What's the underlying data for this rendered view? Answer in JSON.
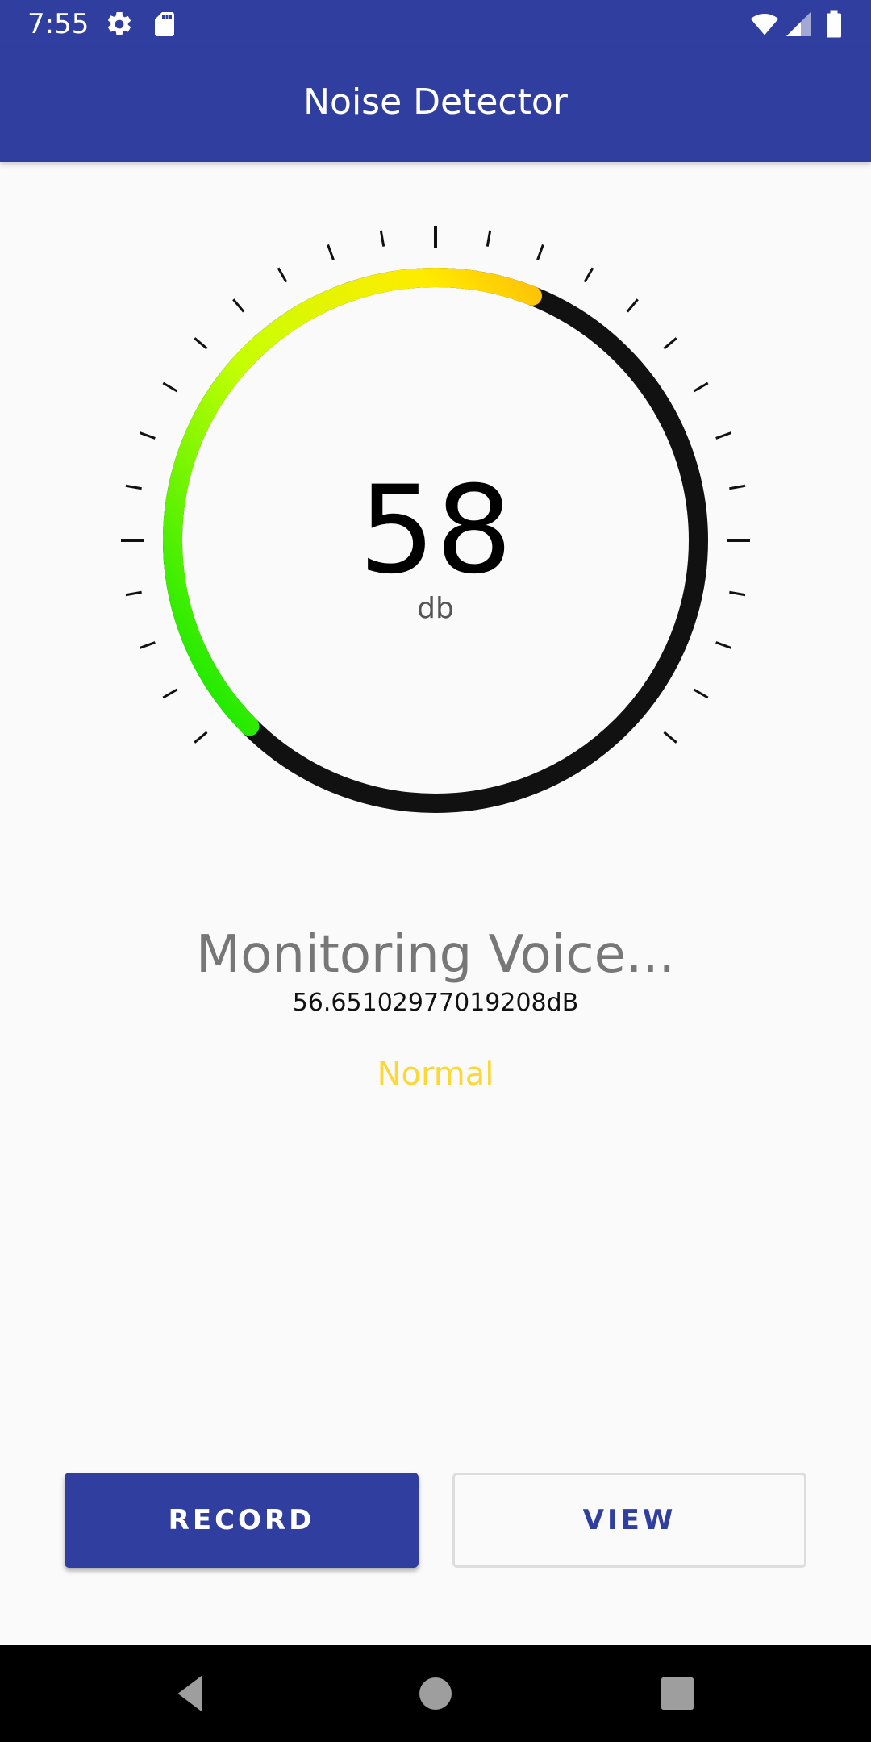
{
  "status_bar": {
    "time": "7:55",
    "icons": [
      "gear-icon",
      "sd-card-icon",
      "wifi-icon",
      "signal-icon",
      "battery-icon"
    ]
  },
  "app_bar": {
    "title": "Noise Detector"
  },
  "gauge": {
    "value": "58",
    "unit": "db",
    "level_fraction": 0.58,
    "colors": {
      "track": "#111111",
      "gradient_start": "#00e600",
      "gradient_mid": "#c6ff00",
      "gradient_end": "#ffc107",
      "ticks": "#111111"
    }
  },
  "monitor": {
    "title": "Monitoring Voice...",
    "reading": "56.65102977019208dB",
    "level": "Normal"
  },
  "buttons": {
    "record_label": "RECORD",
    "view_label": "VIEW"
  },
  "nav_bar": {
    "icons": [
      "back-icon",
      "home-icon",
      "recents-icon"
    ]
  },
  "colors": {
    "primary": "#303f9f",
    "level_color": "#fdd835"
  }
}
